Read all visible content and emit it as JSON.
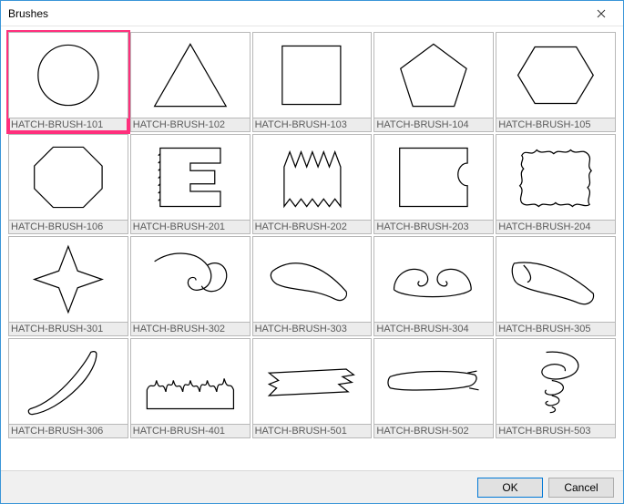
{
  "window": {
    "title": "Brushes"
  },
  "brushes": [
    {
      "label": "HATCH-BRUSH-101",
      "shape": "circle",
      "selected": true
    },
    {
      "label": "HATCH-BRUSH-102",
      "shape": "triangle",
      "selected": false
    },
    {
      "label": "HATCH-BRUSH-103",
      "shape": "square",
      "selected": false
    },
    {
      "label": "HATCH-BRUSH-104",
      "shape": "pentagon",
      "selected": false
    },
    {
      "label": "HATCH-BRUSH-105",
      "shape": "hexagon",
      "selected": false
    },
    {
      "label": "HATCH-BRUSH-106",
      "shape": "octagon",
      "selected": false
    },
    {
      "label": "HATCH-BRUSH-201",
      "shape": "notched-e",
      "selected": false
    },
    {
      "label": "HATCH-BRUSH-202",
      "shape": "zigzag-box",
      "selected": false
    },
    {
      "label": "HATCH-BRUSH-203",
      "shape": "bite-box",
      "selected": false
    },
    {
      "label": "HATCH-BRUSH-204",
      "shape": "ragged-box",
      "selected": false
    },
    {
      "label": "HATCH-BRUSH-301",
      "shape": "star4",
      "selected": false
    },
    {
      "label": "HATCH-BRUSH-302",
      "shape": "swirl",
      "selected": false
    },
    {
      "label": "HATCH-BRUSH-303",
      "shape": "swoosh",
      "selected": false
    },
    {
      "label": "HATCH-BRUSH-304",
      "shape": "curl-double",
      "selected": false
    },
    {
      "label": "HATCH-BRUSH-305",
      "shape": "wing",
      "selected": false
    },
    {
      "label": "HATCH-BRUSH-306",
      "shape": "tail",
      "selected": false
    },
    {
      "label": "HATCH-BRUSH-401",
      "shape": "grass",
      "selected": false
    },
    {
      "label": "HATCH-BRUSH-501",
      "shape": "stroke1",
      "selected": false
    },
    {
      "label": "HATCH-BRUSH-502",
      "shape": "stroke2",
      "selected": false
    },
    {
      "label": "HATCH-BRUSH-503",
      "shape": "tornado",
      "selected": false
    }
  ],
  "footer": {
    "ok": "OK",
    "cancel": "Cancel"
  }
}
